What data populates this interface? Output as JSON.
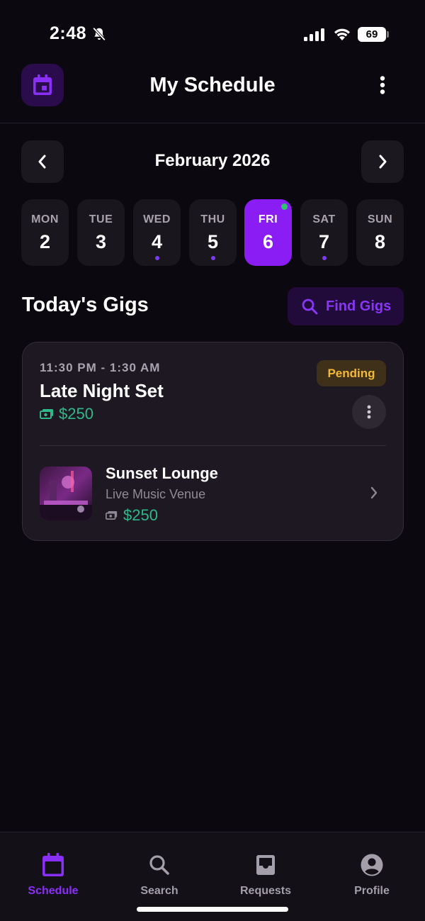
{
  "status_bar": {
    "time": "2:48",
    "battery": "69"
  },
  "header": {
    "title": "My Schedule",
    "calendar_icon": "calendar-icon",
    "more_icon": "more-vertical-icon"
  },
  "month_nav": {
    "label": "February 2026",
    "prev_icon": "chevron-left-icon",
    "next_icon": "chevron-right-icon"
  },
  "week": {
    "days": [
      {
        "name": "MON",
        "num": "2",
        "has_event": false,
        "active": false
      },
      {
        "name": "TUE",
        "num": "3",
        "has_event": false,
        "active": false
      },
      {
        "name": "WED",
        "num": "4",
        "has_event": true,
        "active": false
      },
      {
        "name": "THU",
        "num": "5",
        "has_event": true,
        "active": false
      },
      {
        "name": "FRI",
        "num": "6",
        "has_event": false,
        "active": true,
        "is_today": true
      },
      {
        "name": "SAT",
        "num": "7",
        "has_event": true,
        "active": false
      },
      {
        "name": "SUN",
        "num": "8",
        "has_event": false,
        "active": false
      }
    ]
  },
  "section": {
    "title": "Today's Gigs",
    "find_gigs_label": "Find Gigs",
    "find_gigs_icon": "search-icon"
  },
  "gig": {
    "time": "11:30 PM - 1:30 AM",
    "title": "Late Night Set",
    "pay": "$250",
    "status": "Pending",
    "venue": {
      "name": "Sunset Lounge",
      "type": "Live Music Venue",
      "pay": "$250"
    }
  },
  "bottom_nav": {
    "items": [
      {
        "label": "Schedule",
        "icon": "calendar-icon",
        "active": true
      },
      {
        "label": "Search",
        "icon": "search-icon",
        "active": false
      },
      {
        "label": "Requests",
        "icon": "inbox-icon",
        "active": false
      },
      {
        "label": "Profile",
        "icon": "profile-icon",
        "active": false
      }
    ]
  },
  "colors": {
    "background": "#0c080f",
    "accent": "#8a1cf4",
    "money": "#2fb98a",
    "pending": "#f2b83a",
    "today_dot": "#2fc36d"
  }
}
